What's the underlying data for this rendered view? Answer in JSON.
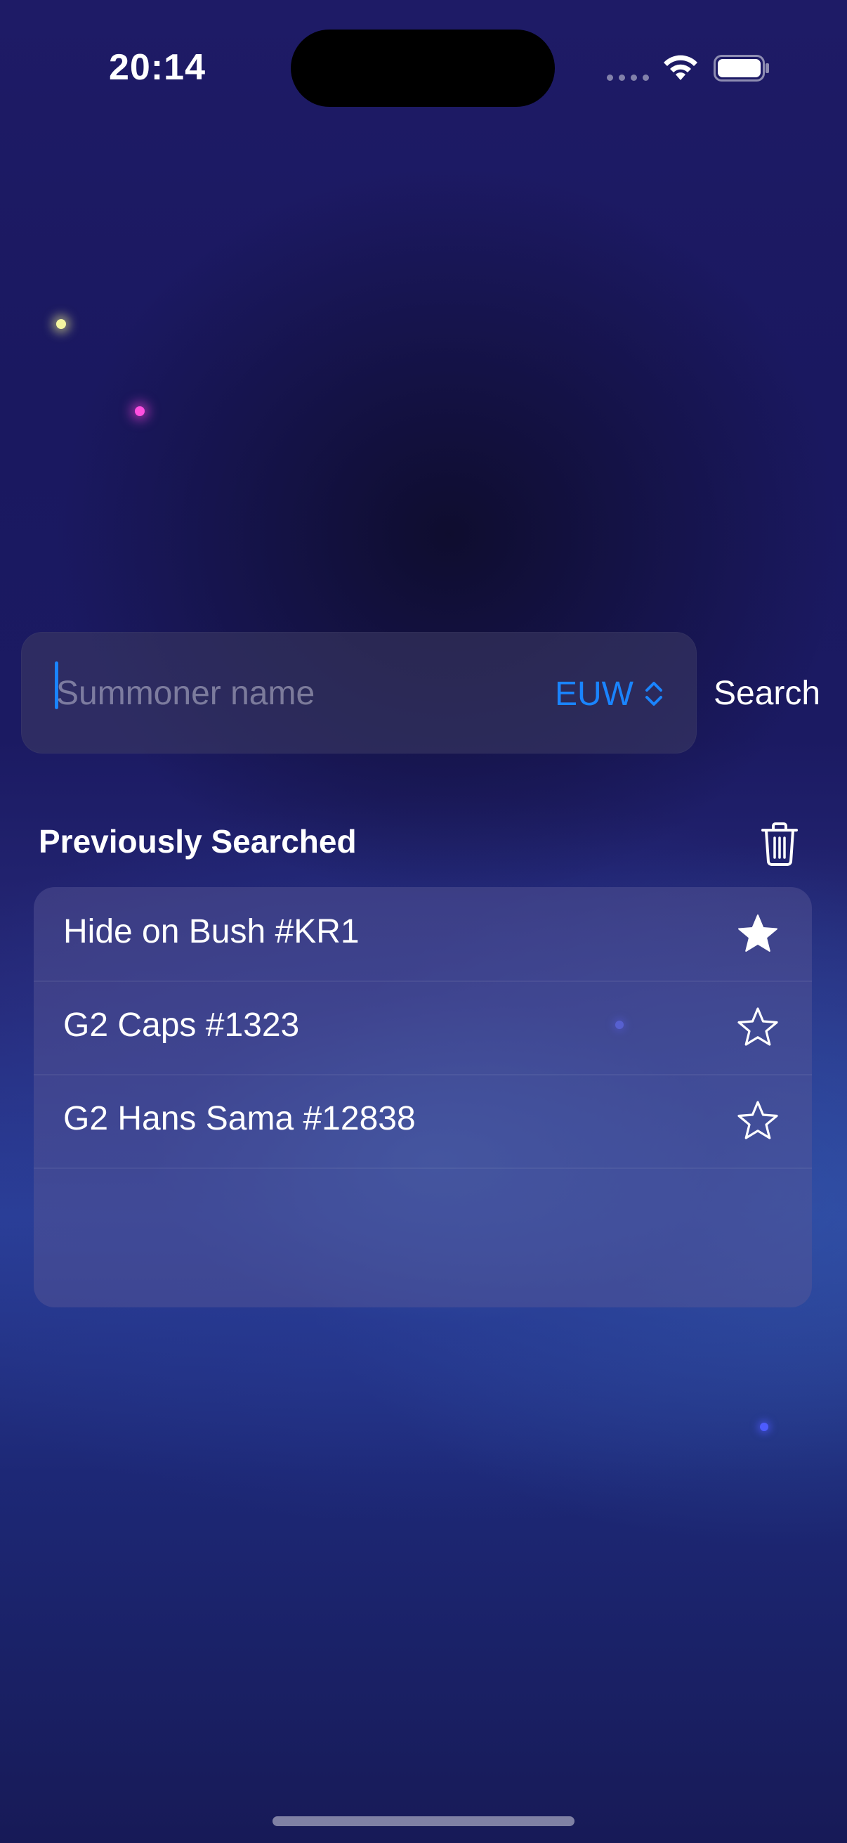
{
  "status_bar": {
    "time": "20:14"
  },
  "search": {
    "placeholder": "Summoner name",
    "value": "",
    "region": "EUW",
    "button_label": "Search"
  },
  "history": {
    "title": "Previously Searched",
    "items": [
      {
        "label": "Hide on Bush #KR1",
        "favorite": true
      },
      {
        "label": "G2 Caps #1323",
        "favorite": false
      },
      {
        "label": "G2 Hans Sama #12838",
        "favorite": false
      }
    ]
  },
  "colors": {
    "accent": "#1a84ff",
    "text": "#ffffff",
    "placeholder": "#8e8ea6"
  },
  "icons": {
    "trash": "trash-icon",
    "favorite": "star-filled-icon",
    "not_favorite": "star-outline-icon",
    "region_picker": "chevron-up-down-icon"
  }
}
